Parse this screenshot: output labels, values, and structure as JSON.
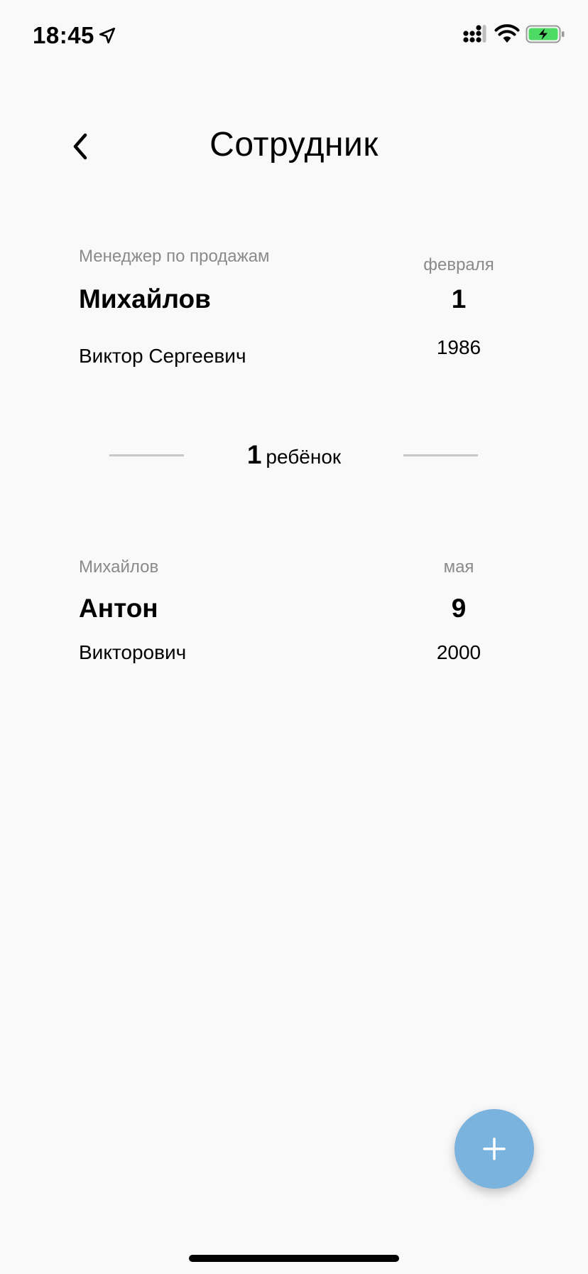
{
  "status_bar": {
    "time": "18:45",
    "icons": [
      "location-arrow-icon",
      "cellular-signal-icon",
      "wifi-icon",
      "battery-charging-icon"
    ],
    "battery_color": "#4cd964"
  },
  "header": {
    "back_icon": "chevron-left-icon",
    "title": "Сотрудник"
  },
  "employee": {
    "position": "Менеджер по продажам",
    "surname": "Михайлов",
    "given_names": "Виктор Сергеевич",
    "birth_month": "февраля",
    "birth_day": "1",
    "birth_year": "1986"
  },
  "children_summary": {
    "count": "1",
    "word": "ребёнок"
  },
  "children": [
    {
      "surname": "Михайлов",
      "first_name": "Антон",
      "patronymic": "Викторович",
      "birth_month": "мая",
      "birth_day": "9",
      "birth_year": "2000"
    }
  ],
  "fab": {
    "icon": "plus-icon",
    "color": "#7ab3de"
  }
}
